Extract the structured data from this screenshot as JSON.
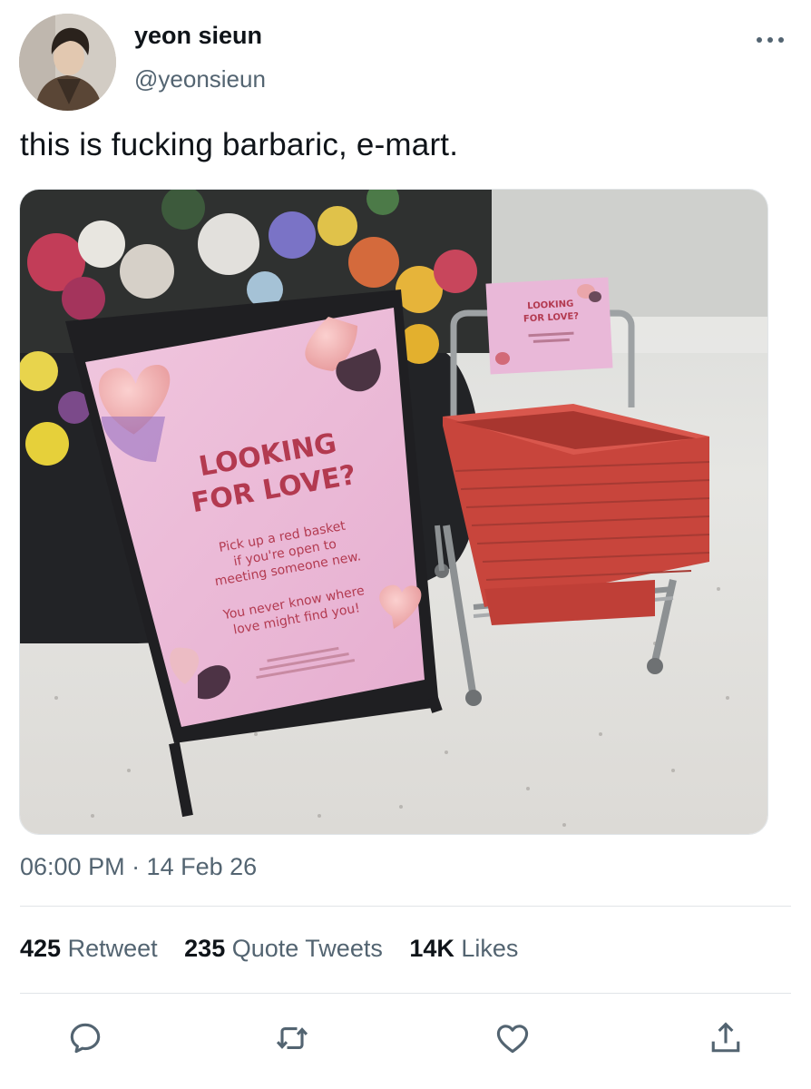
{
  "author": {
    "name": "yeon sieun",
    "handle": "@yeonsieun"
  },
  "tweet": {
    "text": "this is fucking barbaric, e-mart."
  },
  "photo": {
    "sign": {
      "title_line1": "LOOKING",
      "title_line2": "FOR LOVE?",
      "body1_line1": "Pick up a red basket",
      "body1_line2": "if you're open to",
      "body1_line3": "meeting someone new.",
      "body2_line1": "You never know where",
      "body2_line2": "love might find you!"
    },
    "small_sign": {
      "title_line1": "LOOKING",
      "title_line2": "FOR LOVE?"
    }
  },
  "meta": {
    "timestamp": "06:00 PM · 14 Feb 26"
  },
  "stats": {
    "retweets_count": "425",
    "retweets_label": "Retweet",
    "quotes_count": "235",
    "quotes_label": "Quote Tweets",
    "likes_count": "14K",
    "likes_label": "Likes"
  },
  "icons": {
    "reply": "reply-icon",
    "retweet": "retweet-icon",
    "like": "heart-icon",
    "share": "share-icon",
    "more": "more-icon"
  },
  "colors": {
    "text_primary": "#0f1419",
    "text_secondary": "#536471",
    "divider": "#e1e5e8",
    "sign_pink": "#e8b4d8",
    "sign_text": "#b33a50",
    "basket_red": "#c8453c"
  }
}
